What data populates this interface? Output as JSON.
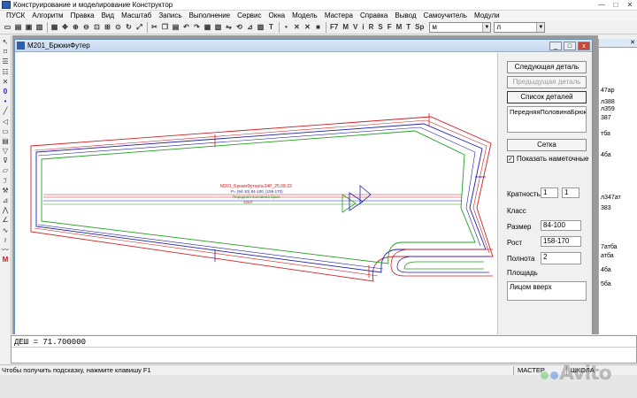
{
  "window": {
    "title": "Конструирование и моделирование  Конструктор",
    "minimize": "—",
    "maximize": "□",
    "close": "✕"
  },
  "menu": [
    "ПУСК",
    "Алгоритм",
    "Правка",
    "Вид",
    "Масштаб",
    "Запись",
    "Выполнение",
    "Сервис",
    "Окна",
    "Модель",
    "Мастера",
    "Справка",
    "Вывод",
    "Самоучитель",
    "Модули"
  ],
  "toolbar": {
    "letters": [
      "F7",
      "M",
      "V",
      "i",
      "R",
      "S",
      "F",
      "M",
      "T",
      "Sp"
    ],
    "combo1": "м",
    "combo2": "л"
  },
  "child_window": {
    "title": "М201_БрюкиФутер",
    "minimize": "_",
    "maximize": "□",
    "close": "x"
  },
  "panel": {
    "next_detail": "Следующая деталь",
    "prev_detail": "Предыдущая деталь",
    "detail_list": "Список деталей",
    "list_item": "ПередняяПоловинаБрюк",
    "grid_button": "Сетка",
    "show_basting": "Показать наметочные",
    "show_basting_checked": "✓",
    "multiplicity_label": "Кратность",
    "multiplicity_1": "1",
    "multiplicity_2": "1",
    "class_label": "Класс",
    "size_label": "Размер",
    "size_value": "84-100",
    "height_label": "Рост",
    "height_value": "158-170",
    "fullness_label": "Полнота",
    "fullness_value": "2",
    "area_label": "Площадь",
    "face_up": "Лицом вверх"
  },
  "drawing": {
    "label_line1": "М201_БрюкиФутер№34Р_25.08-22",
    "label_line2": "Р= (94-10) 84-100, (158-170)",
    "label_line3": "Передняя половина брюк",
    "label_line4": "32шт"
  },
  "right_window": {
    "labels": [
      "47ар",
      "л388",
      "л359",
      "387",
      "тба",
      "4ба",
      "л347ат",
      "383",
      "7атба",
      "атба",
      "4ба",
      "5ба"
    ]
  },
  "command_line": "ДЕШ = 71.700000",
  "status": {
    "hint": "Чтобы получить подсказку, нажмите клавишу F1",
    "mode": "МАСТЕР",
    "seg2": "ШКОЛА"
  },
  "watermark": "Avito",
  "colors": {
    "red": "#d02020",
    "blue": "#2020b0",
    "green": "#20a020",
    "title_blue": "#c4d7ef"
  }
}
